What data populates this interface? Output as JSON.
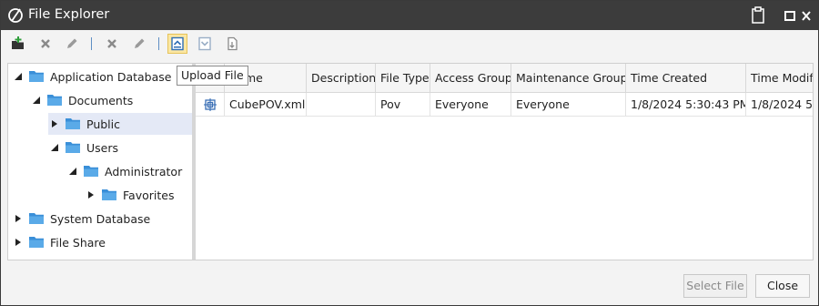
{
  "window": {
    "title": "File Explorer"
  },
  "titlebar_buttons": [
    {
      "name": "clipboard-icon"
    },
    {
      "name": "maximize-icon"
    },
    {
      "name": "close-icon"
    }
  ],
  "toolbar": {
    "tooltip": "Upload File"
  },
  "tree": {
    "nodes": [
      {
        "label": "Application Database",
        "expanded": true
      },
      {
        "label": "Documents",
        "expanded": true
      },
      {
        "label": "Public",
        "expanded": false,
        "selected": true
      },
      {
        "label": "Users",
        "expanded": true
      },
      {
        "label": "Administrator",
        "expanded": true
      },
      {
        "label": "Favorites",
        "expanded": false
      },
      {
        "label": "System Database",
        "expanded": false
      },
      {
        "label": "File Share",
        "expanded": false
      }
    ]
  },
  "grid": {
    "columns": [
      "Name",
      "Description",
      "File Type",
      "Access Group",
      "Maintenance Group",
      "Time Created",
      "Time Modif"
    ],
    "rows": [
      {
        "icon": "cube-pov-file-icon",
        "name": "CubePOV.xml",
        "description": "",
        "file_type": "Pov",
        "access_group": "Everyone",
        "maintenance_group": "Everyone",
        "time_created": "1/8/2024 5:30:43 PM",
        "time_modified": "1/8/2024 5:"
      }
    ]
  },
  "footer": {
    "select_label": "Select File",
    "close_label": "Close"
  },
  "colors": {
    "titlebar": "#3c3c3c",
    "folder": "#3a8fd8",
    "selected_row": "#e4e9f6",
    "tool_active": "#fbe7a3"
  }
}
